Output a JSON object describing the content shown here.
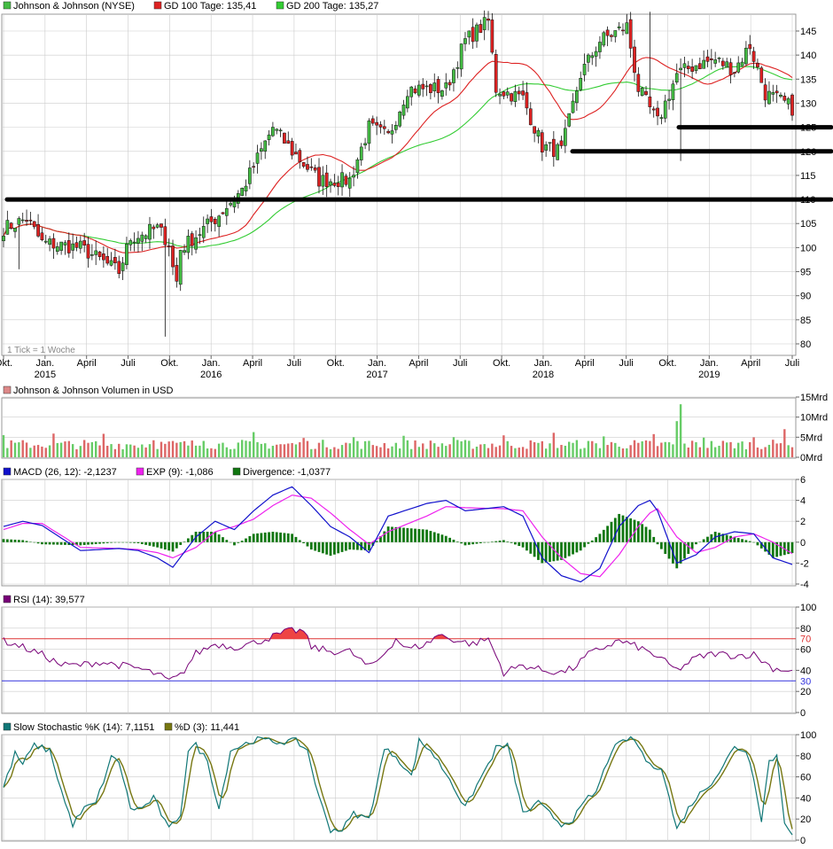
{
  "header": {
    "legend": [
      {
        "label": "Johnson & Johnson (NYSE)",
        "color": "#44bb44"
      },
      {
        "label": "GD 100 Tage: 135,41",
        "color": "#dd2222"
      },
      {
        "label": "GD 200 Tage: 135,27",
        "color": "#33cc33"
      }
    ],
    "tick_note": "1 Tick = 1 Woche"
  },
  "time_axis": {
    "month_labels": [
      "Okt.",
      "Jan.",
      "April",
      "Juli",
      "Okt.",
      "Jan.",
      "April",
      "Juli",
      "Okt.",
      "Jan.",
      "April",
      "Juli",
      "Okt.",
      "Jan.",
      "April",
      "Juli",
      "Okt.",
      "Jan.",
      "April",
      "Juli"
    ],
    "year_labels": [
      "2015",
      "2016",
      "2017",
      "2018",
      "2019"
    ]
  },
  "colors": {
    "up": "#44bb44",
    "down": "#dd2222",
    "ma100": "#dd2222",
    "ma200": "#33cc33",
    "macd": "#1111cc",
    "signal": "#ee22ee",
    "divergence": "#117711",
    "rsi": "#770077",
    "stoch_k": "#117777",
    "stoch_d": "#777711",
    "grid": "#cccccc"
  },
  "chart_data": [
    {
      "type": "candlestick",
      "title": "Johnson & Johnson (NYSE)",
      "ylim": [
        75,
        150
      ],
      "y_ticks": [
        "80",
        "85",
        "90",
        "95",
        "100",
        "105",
        "110",
        "115",
        "120",
        "125",
        "130",
        "135",
        "140",
        "145"
      ],
      "x_range": [
        "2014-10",
        "2019-08"
      ],
      "series": [
        {
          "name": "GD 100 Tage: 135,41",
          "last": 135.41
        },
        {
          "name": "GD 200 Tage: 135,27",
          "last": 135.27
        }
      ],
      "close_anchors": [
        [
          0,
          104
        ],
        [
          6,
          106
        ],
        [
          10,
          101
        ],
        [
          20,
          100
        ],
        [
          30,
          95
        ],
        [
          33,
          102
        ],
        [
          40,
          104
        ],
        [
          45,
          99
        ],
        [
          55,
          106
        ],
        [
          62,
          112
        ],
        [
          70,
          125
        ],
        [
          75,
          120
        ],
        [
          82,
          114
        ],
        [
          90,
          114
        ],
        [
          95,
          125
        ],
        [
          100,
          123
        ],
        [
          105,
          133
        ],
        [
          115,
          133
        ],
        [
          120,
          143
        ],
        [
          126,
          147
        ],
        [
          128,
          133
        ],
        [
          135,
          131
        ],
        [
          140,
          121
        ],
        [
          145,
          120
        ],
        [
          150,
          136
        ],
        [
          155,
          143
        ],
        [
          162,
          146
        ],
        [
          165,
          133
        ],
        [
          170,
          126
        ],
        [
          175,
          136
        ],
        [
          180,
          138
        ],
        [
          185,
          139
        ],
        [
          190,
          137
        ],
        [
          194,
          142
        ],
        [
          198,
          132
        ],
        [
          203,
          130
        ],
        [
          205,
          129
        ]
      ],
      "annotations": [
        {
          "type": "horizontal-line",
          "y": 110
        },
        {
          "type": "horizontal-line",
          "y": 120,
          "from": "2018-04"
        },
        {
          "type": "horizontal-line",
          "y": 125,
          "from": "2018-12"
        }
      ]
    },
    {
      "type": "bar",
      "title": "Johnson & Johnson Volumen in USD",
      "ylim": [
        0,
        15
      ],
      "y_ticks": [
        "0Mrd",
        "5Mrd",
        "10Mrd",
        "15Mrd"
      ],
      "spikes": [
        {
          "week": 175,
          "value": 9
        },
        {
          "week": 176,
          "value": 13.2
        },
        {
          "week": 203,
          "value": 7
        }
      ]
    },
    {
      "type": "line",
      "title": "MACD (26, 12)",
      "ylim": [
        -4.5,
        6
      ],
      "y_ticks": [
        "-4",
        "-2",
        "0",
        "2",
        "4",
        "6"
      ],
      "series": [
        {
          "name": "MACD (26, 12): -2,1237",
          "last": -2.1237
        },
        {
          "name": "EXP (9): -1,086",
          "last": -1.086
        },
        {
          "name": "Divergence: -1,0377",
          "last": -1.0377
        }
      ],
      "macd_anchors": [
        [
          0,
          1.5
        ],
        [
          5,
          2.0
        ],
        [
          10,
          1.6
        ],
        [
          20,
          -0.8
        ],
        [
          30,
          -0.6
        ],
        [
          35,
          -0.8
        ],
        [
          40,
          -1.5
        ],
        [
          44,
          -2.4
        ],
        [
          50,
          0.5
        ],
        [
          55,
          2.0
        ],
        [
          60,
          1.2
        ],
        [
          65,
          3
        ],
        [
          70,
          4.5
        ],
        [
          75,
          5.3
        ],
        [
          80,
          3.5
        ],
        [
          85,
          1.5
        ],
        [
          90,
          0.5
        ],
        [
          95,
          -1.0
        ],
        [
          100,
          2.5
        ],
        [
          110,
          3.7
        ],
        [
          115,
          4.0
        ],
        [
          120,
          3.0
        ],
        [
          130,
          3.4
        ],
        [
          135,
          2.5
        ],
        [
          140,
          -1.5
        ],
        [
          145,
          -3.2
        ],
        [
          150,
          -3.8
        ],
        [
          155,
          -2.5
        ],
        [
          160,
          1.5
        ],
        [
          165,
          3.5
        ],
        [
          168,
          4.0
        ],
        [
          170,
          3.0
        ],
        [
          175,
          -2.0
        ],
        [
          180,
          -1.2
        ],
        [
          185,
          0.5
        ],
        [
          190,
          1.0
        ],
        [
          195,
          0.8
        ],
        [
          200,
          -1.5
        ],
        [
          205,
          -2.1237
        ]
      ],
      "signal_anchors": [
        [
          0,
          1.2
        ],
        [
          5,
          1.8
        ],
        [
          10,
          1.8
        ],
        [
          20,
          -0.5
        ],
        [
          30,
          -0.6
        ],
        [
          35,
          -0.7
        ],
        [
          40,
          -1.0
        ],
        [
          44,
          -1.5
        ],
        [
          50,
          -0.5
        ],
        [
          55,
          1.0
        ],
        [
          60,
          1.5
        ],
        [
          65,
          2.2
        ],
        [
          70,
          3.5
        ],
        [
          75,
          4.5
        ],
        [
          80,
          4.2
        ],
        [
          85,
          2.8
        ],
        [
          90,
          1.2
        ],
        [
          95,
          -0.2
        ],
        [
          100,
          1.0
        ],
        [
          110,
          2.5
        ],
        [
          115,
          3.4
        ],
        [
          120,
          3.3
        ],
        [
          130,
          3.2
        ],
        [
          135,
          3.0
        ],
        [
          140,
          0.5
        ],
        [
          145,
          -1.5
        ],
        [
          150,
          -3.0
        ],
        [
          155,
          -3.3
        ],
        [
          160,
          -1.2
        ],
        [
          165,
          1.5
        ],
        [
          168,
          2.8
        ],
        [
          170,
          3.2
        ],
        [
          175,
          0.5
        ],
        [
          180,
          -1.0
        ],
        [
          185,
          -0.5
        ],
        [
          190,
          0.5
        ],
        [
          195,
          0.8
        ],
        [
          200,
          0.0
        ],
        [
          205,
          -1.086
        ]
      ]
    },
    {
      "type": "line",
      "title": "RSI (14): 39,577",
      "ylim": [
        0,
        100
      ],
      "y_ticks": [
        "0",
        "20",
        "40",
        "60",
        "80",
        "100"
      ],
      "reference_lines": [
        {
          "value": 70,
          "label": "70",
          "color": "#dd3333"
        },
        {
          "value": 30,
          "label": "30",
          "color": "#3333dd"
        }
      ],
      "anchors": [
        [
          0,
          68
        ],
        [
          5,
          62
        ],
        [
          10,
          55
        ],
        [
          15,
          45
        ],
        [
          20,
          45
        ],
        [
          25,
          48
        ],
        [
          30,
          45
        ],
        [
          35,
          42
        ],
        [
          40,
          36
        ],
        [
          43,
          30
        ],
        [
          46,
          35
        ],
        [
          50,
          56
        ],
        [
          55,
          65
        ],
        [
          60,
          62
        ],
        [
          65,
          66
        ],
        [
          70,
          72
        ],
        [
          75,
          78
        ],
        [
          78,
          77
        ],
        [
          80,
          62
        ],
        [
          85,
          58
        ],
        [
          90,
          58
        ],
        [
          95,
          43
        ],
        [
          98,
          52
        ],
        [
          102,
          70
        ],
        [
          105,
          60
        ],
        [
          110,
          65
        ],
        [
          113,
          74
        ],
        [
          118,
          68
        ],
        [
          122,
          65
        ],
        [
          126,
          70
        ],
        [
          130,
          38
        ],
        [
          135,
          45
        ],
        [
          140,
          40
        ],
        [
          145,
          38
        ],
        [
          148,
          42
        ],
        [
          152,
          55
        ],
        [
          156,
          62
        ],
        [
          160,
          68
        ],
        [
          165,
          62
        ],
        [
          170,
          53
        ],
        [
          175,
          40
        ],
        [
          180,
          52
        ],
        [
          185,
          56
        ],
        [
          190,
          54
        ],
        [
          195,
          55
        ],
        [
          200,
          42
        ],
        [
          205,
          39.577
        ]
      ]
    },
    {
      "type": "line",
      "title": "Slow Stochastic",
      "ylim": [
        0,
        100
      ],
      "y_ticks": [
        "0",
        "20",
        "40",
        "60",
        "80",
        "100"
      ],
      "series": [
        {
          "name": "Slow Stochastic %K (14): 7,1151",
          "last": 7.1151
        },
        {
          "name": "%D (3): 11,441",
          "last": 11.441
        }
      ],
      "anchors": [
        [
          0,
          50
        ],
        [
          3,
          82
        ],
        [
          5,
          72
        ],
        [
          8,
          90
        ],
        [
          12,
          85
        ],
        [
          16,
          35
        ],
        [
          18,
          15
        ],
        [
          21,
          30
        ],
        [
          24,
          35
        ],
        [
          28,
          78
        ],
        [
          30,
          75
        ],
        [
          33,
          30
        ],
        [
          36,
          30
        ],
        [
          39,
          40
        ],
        [
          43,
          10
        ],
        [
          46,
          25
        ],
        [
          48,
          85
        ],
        [
          50,
          90
        ],
        [
          53,
          75
        ],
        [
          56,
          30
        ],
        [
          59,
          85
        ],
        [
          62,
          90
        ],
        [
          66,
          96
        ],
        [
          71,
          93
        ],
        [
          76,
          94
        ],
        [
          79,
          85
        ],
        [
          82,
          40
        ],
        [
          85,
          10
        ],
        [
          88,
          10
        ],
        [
          91,
          25
        ],
        [
          95,
          20
        ],
        [
          99,
          86
        ],
        [
          102,
          80
        ],
        [
          106,
          60
        ],
        [
          108,
          94
        ],
        [
          111,
          85
        ],
        [
          116,
          58
        ],
        [
          120,
          30
        ],
        [
          122,
          45
        ],
        [
          126,
          72
        ],
        [
          128,
          87
        ],
        [
          131,
          90
        ],
        [
          135,
          25
        ],
        [
          139,
          35
        ],
        [
          142,
          25
        ],
        [
          145,
          15
        ],
        [
          148,
          20
        ],
        [
          152,
          40
        ],
        [
          154,
          45
        ],
        [
          158,
          85
        ],
        [
          162,
          96
        ],
        [
          164,
          95
        ],
        [
          168,
          70
        ],
        [
          171,
          70
        ],
        [
          173,
          40
        ],
        [
          175,
          10
        ],
        [
          178,
          30
        ],
        [
          180,
          40
        ],
        [
          184,
          55
        ],
        [
          186,
          65
        ],
        [
          190,
          88
        ],
        [
          193,
          85
        ],
        [
          195,
          60
        ],
        [
          197,
          20
        ],
        [
          199,
          75
        ],
        [
          201,
          80
        ],
        [
          203,
          18
        ],
        [
          205,
          7.1
        ]
      ]
    }
  ]
}
